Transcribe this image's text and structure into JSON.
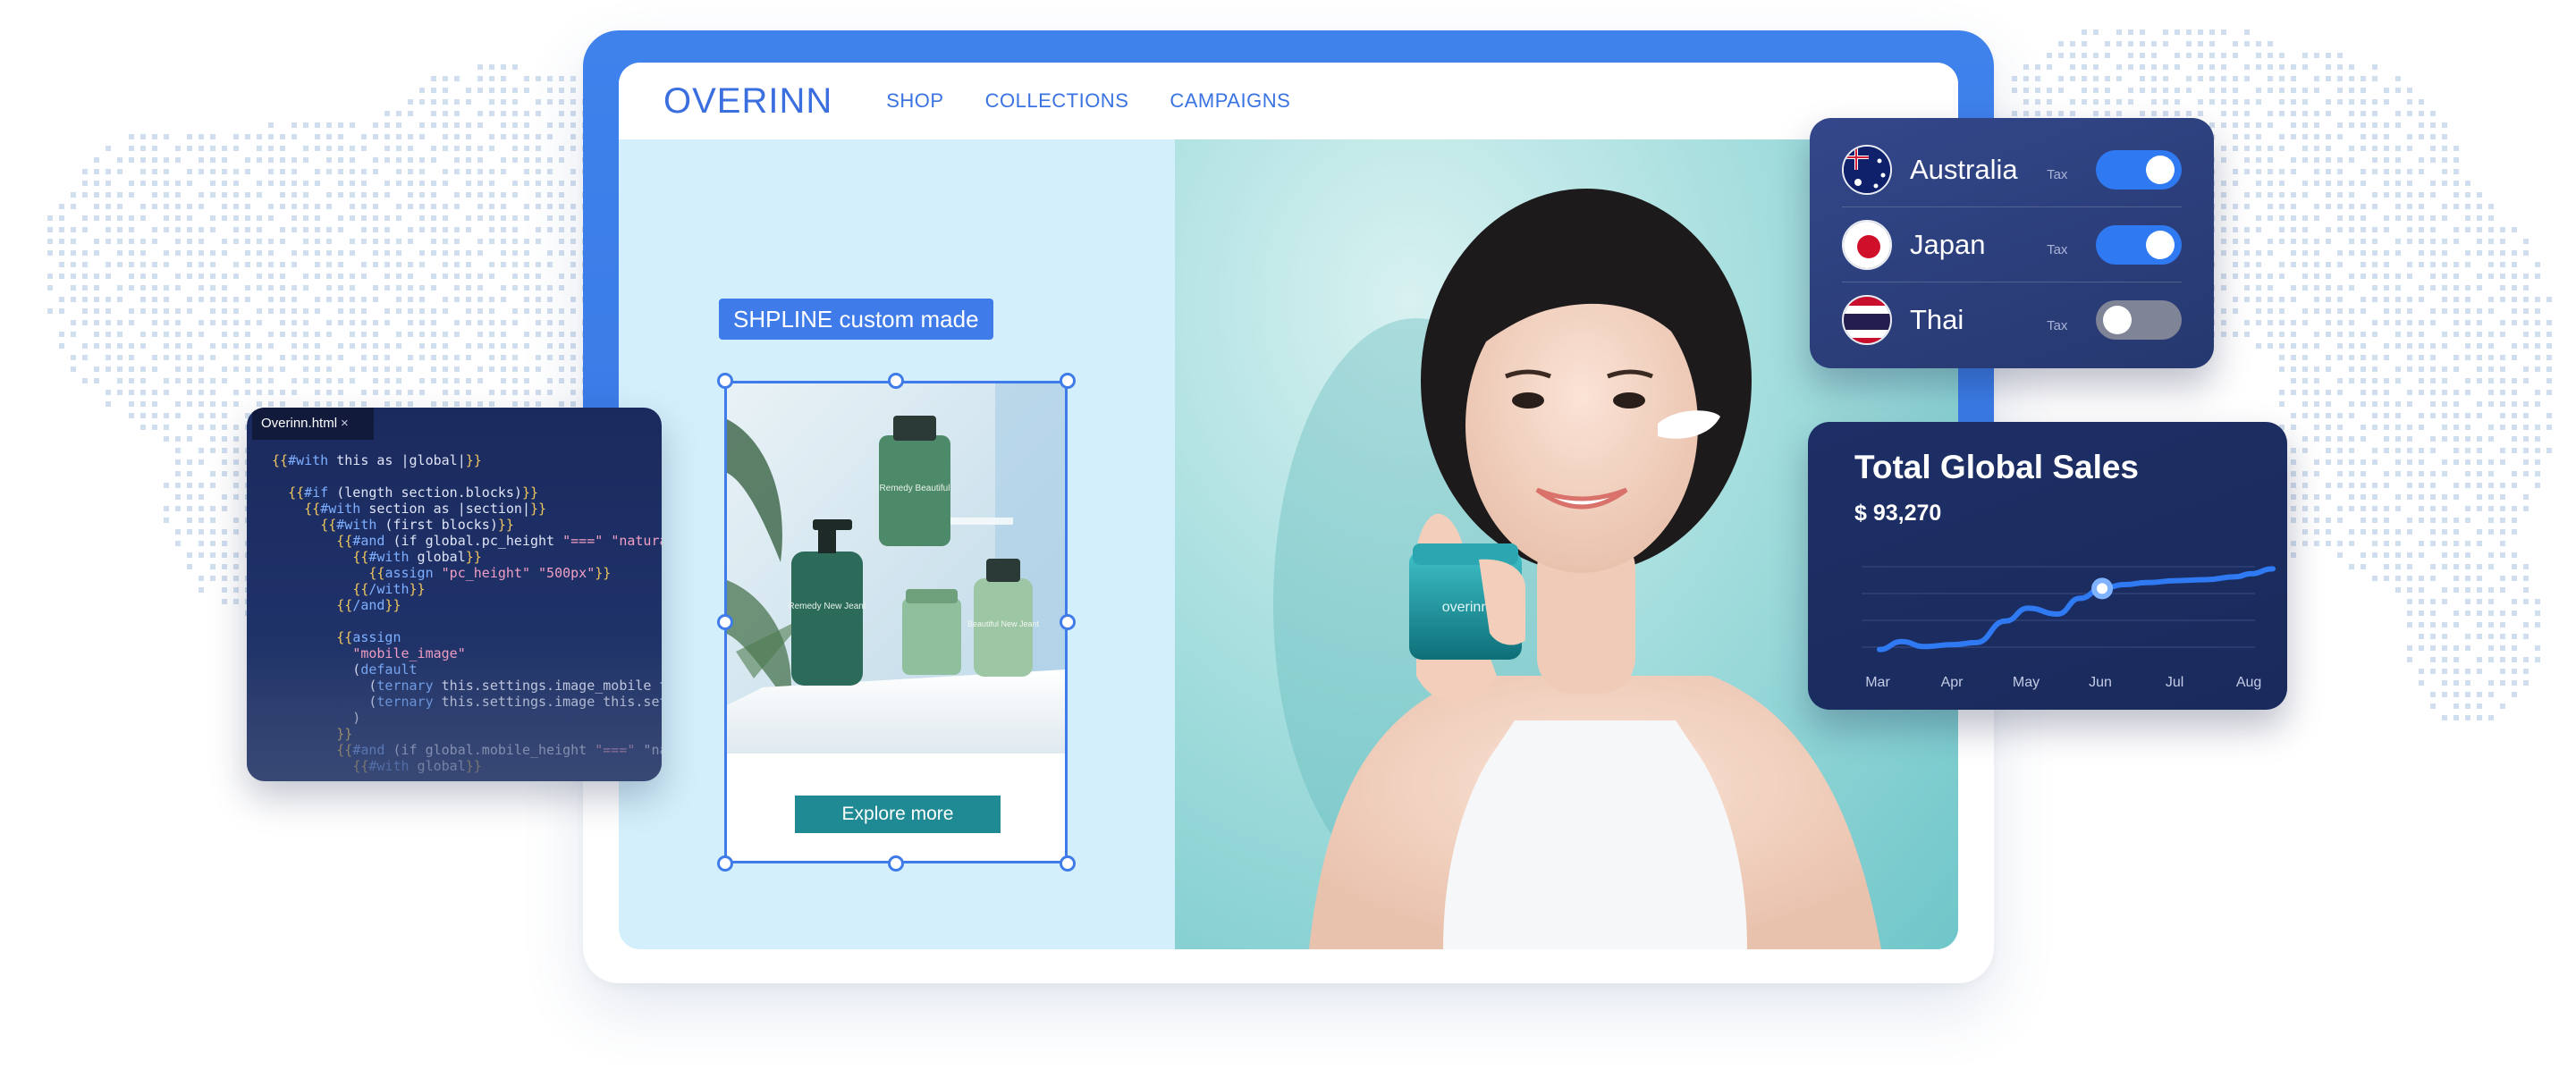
{
  "site": {
    "logo": "OVERINN",
    "nav": [
      "SHOP",
      "COLLECTIONS",
      "CAMPAIGNS"
    ]
  },
  "editor": {
    "badge": "SHPLINE custom made",
    "explore_button": "Explore more",
    "product_label_top": "Remedy Beautiful",
    "product_label_left": "Remedy New Jeant",
    "product_label_right": "Beautiful New Jeant",
    "jar_label": "overinn"
  },
  "code_panel": {
    "tab_name": "Overinn.html",
    "close_glyph": "×",
    "lines": [
      "{{#with this as |global|}}",
      "",
      "  {{#if (length section.blocks)}}",
      "    {{#with section as |section|}}",
      "      {{#with (first blocks)}}",
      "        {{#and (if global.pc_height \"===\" \"natural\")}}",
      "          {{#with global}}",
      "            {{assign \"pc_height\" \"500px\"}}",
      "          {{/with}}",
      "        {{/and}}",
      "",
      "        {{assign",
      "          \"mobile_image\"",
      "          (default",
      "            (ternary this.settings.image_mobile this",
      "            (ternary this.settings.image this.settin",
      "          )",
      "        }}",
      "        {{#and (if global.mobile_height \"===\" \"natur",
      "          {{#with global}}"
    ]
  },
  "tax": {
    "rows": [
      {
        "country": "Australia",
        "label": "Tax",
        "enabled": true
      },
      {
        "country": "Japan",
        "label": "Tax",
        "enabled": true
      },
      {
        "country": "Thai",
        "label": "Tax",
        "enabled": false
      }
    ]
  },
  "sales": {
    "title": "Total Global Sales",
    "value": "$ 93,270"
  },
  "chart_data": {
    "type": "line",
    "title": "Total Global Sales",
    "categories": [
      "Mar",
      "Apr",
      "May",
      "Jun",
      "Jul",
      "Aug"
    ],
    "x": [
      0,
      0.3,
      0.6,
      1.0,
      1.3,
      1.7,
      2.0,
      2.4,
      2.7,
      3.0,
      3.3,
      3.6,
      4.0,
      4.4,
      4.8,
      5.0,
      5.3
    ],
    "values": [
      14,
      22,
      17,
      19,
      21,
      43,
      56,
      50,
      66,
      76,
      80,
      82,
      84,
      85,
      88,
      91,
      96
    ],
    "highlight_index": 9,
    "ylim": [
      0,
      100
    ],
    "grid": true,
    "colors": {
      "line": "#2f7af2",
      "highlight": "#ffffff",
      "grid": "#3a4c82",
      "tick": "#c4cbe6"
    }
  },
  "colors": {
    "brand_blue": "#3f7cea",
    "teal_button": "#1f8a93",
    "panel_navy": "#1d2f66"
  }
}
